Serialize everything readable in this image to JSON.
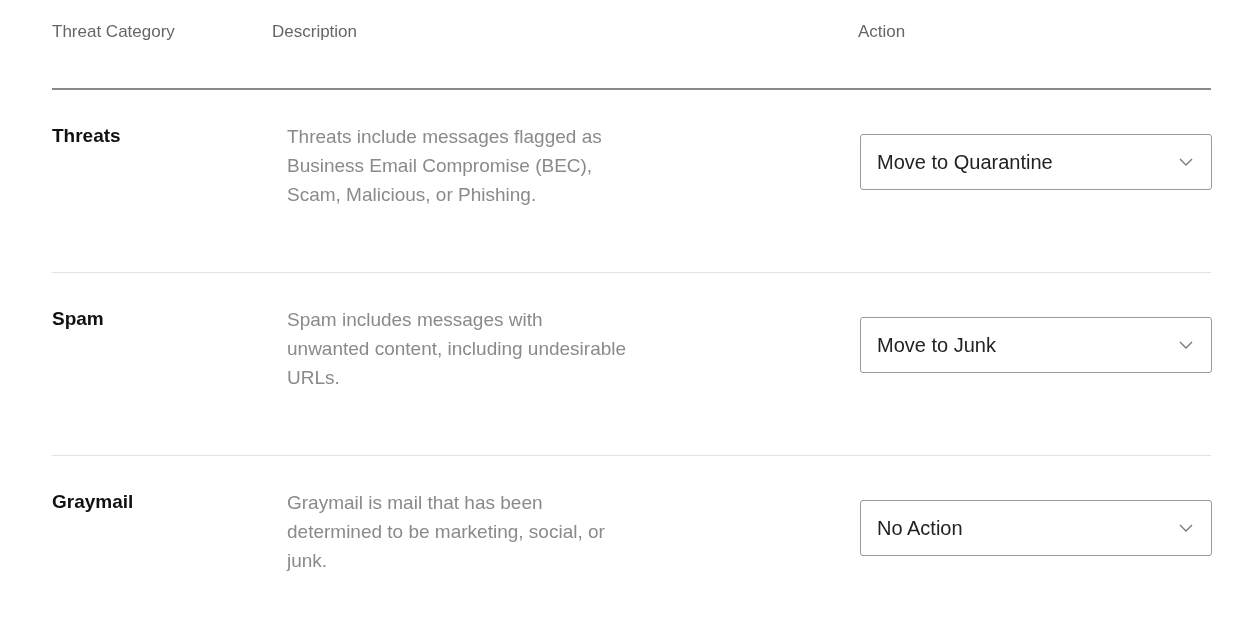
{
  "table": {
    "columns": [
      "Threat Category",
      "Description",
      "Action"
    ],
    "rows": [
      {
        "category": "Threats",
        "description": "Threats include messages flagged as Business Email Compromise (BEC), Scam, Malicious, or Phishing.",
        "action": "Move to Quarantine"
      },
      {
        "category": "Spam",
        "description": "Spam includes messages with unwanted content, including undesirable URLs.",
        "action": "Move to Junk"
      },
      {
        "category": "Graymail",
        "description": "Graymail is mail that has been determined to be marketing, social, or junk.",
        "action": "No Action"
      }
    ]
  }
}
